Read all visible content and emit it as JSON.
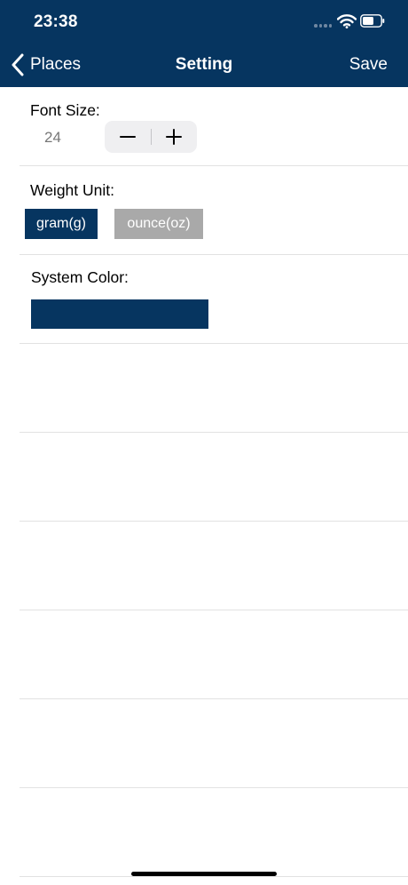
{
  "status_bar": {
    "time": "23:38"
  },
  "nav": {
    "back_label": "Places",
    "title": "Setting",
    "save_label": "Save"
  },
  "font_size": {
    "label": "Font Size:",
    "value": "24"
  },
  "weight_unit": {
    "label": "Weight Unit:",
    "options": [
      "gram(g)",
      "ounce(oz)"
    ],
    "selected": "gram(g)"
  },
  "system_color": {
    "label": "System Color:",
    "value": "#063560"
  },
  "colors": {
    "primary": "#063560",
    "unselected": "#a9a9a9",
    "divider": "#e2e2e2"
  }
}
